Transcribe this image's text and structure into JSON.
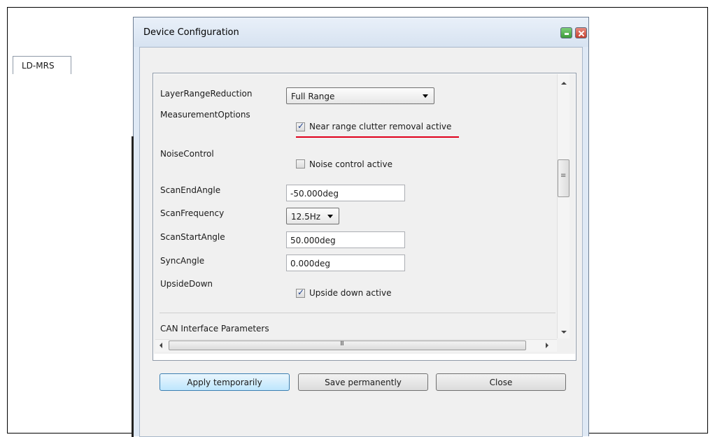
{
  "window": {
    "title": "Device Configuration"
  },
  "tabs": [
    {
      "label": "LD-MRS"
    }
  ],
  "params": {
    "layer_range_reduction": {
      "label": "LayerRangeReduction",
      "value": "Full Range"
    },
    "measurement_options": {
      "label": "MeasurementOptions",
      "checkbox_label": "Near range clutter removal active",
      "checked": true
    },
    "noise_control": {
      "label": "NoiseControl",
      "checkbox_label": "Noise control active",
      "checked": false
    },
    "scan_end_angle": {
      "label": "ScanEndAngle",
      "value": "-50.000deg"
    },
    "scan_frequency": {
      "label": "ScanFrequency",
      "value": "12.5Hz"
    },
    "scan_start_angle": {
      "label": "ScanStartAngle",
      "value": "50.000deg"
    },
    "sync_angle": {
      "label": "SyncAngle",
      "value": "0.000deg"
    },
    "upside_down": {
      "label": "UpsideDown",
      "checkbox_label": "Upside down active",
      "checked": true
    }
  },
  "section": {
    "can_interface": "CAN Interface Parameters"
  },
  "buttons": {
    "apply": "Apply temporarily",
    "save": "Save permanently",
    "close": "Close"
  },
  "colors": {
    "highlight_underline": "#e0001b",
    "titlebar": "#dfe9f5"
  }
}
